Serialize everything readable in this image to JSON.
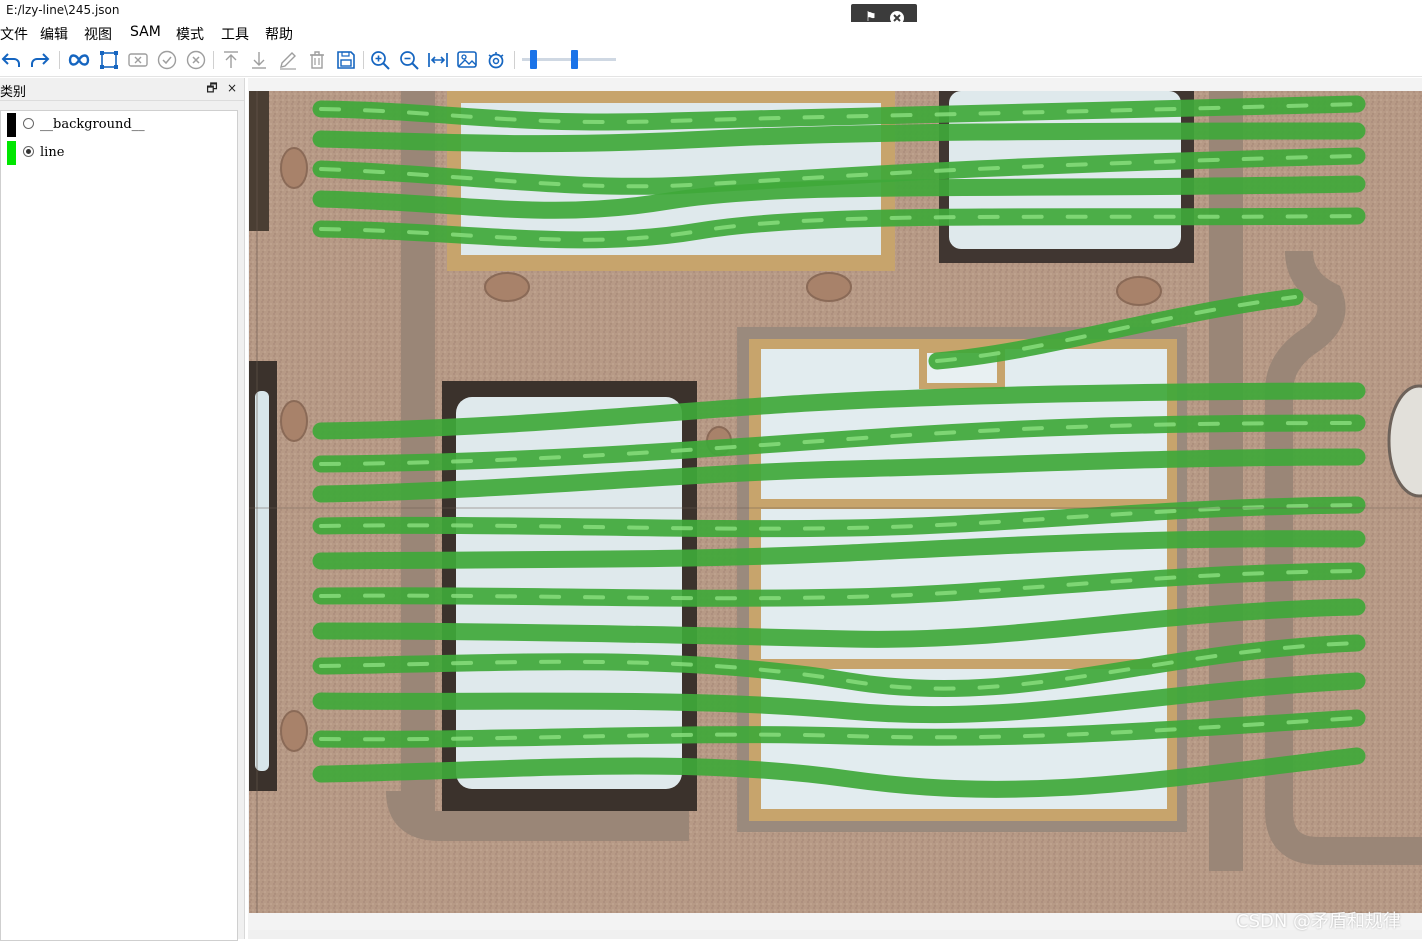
{
  "window": {
    "title": "E:/lzy-line\\245.json"
  },
  "menu": {
    "items": [
      "文件",
      "编辑",
      "视图",
      "SAM",
      "模式",
      "工具",
      "帮助"
    ]
  },
  "toolbar": {
    "buttons": [
      "undo-icon",
      "redo-icon",
      "sam-icon",
      "rectangle-icon",
      "delete-shape-icon",
      "confirm-icon",
      "cancel-icon",
      "bring-to-top-icon",
      "send-to-bottom-icon",
      "edit-icon",
      "trash-icon",
      "save-icon",
      "zoom-in-icon",
      "zoom-out-icon",
      "fit-width-icon",
      "image-icon",
      "settings-icon"
    ],
    "slider": {
      "low": 0.12,
      "high": 0.55
    }
  },
  "dock": {
    "title": "类别",
    "float_glyph": "🗗",
    "close_glyph": "×"
  },
  "classes": [
    {
      "name": "__background__",
      "color": "#000000",
      "selected": false
    },
    {
      "name": "line",
      "color": "#00e600",
      "selected": true
    }
  ],
  "overlay": {
    "icons": [
      "flag-icon",
      "close-circle-icon"
    ]
  },
  "watermark": "CSDN @矛盾和规律",
  "colors": {
    "accent": "#1a73e8",
    "toolbar_icon": "#1565c0",
    "annotation": "#3fa83a"
  }
}
